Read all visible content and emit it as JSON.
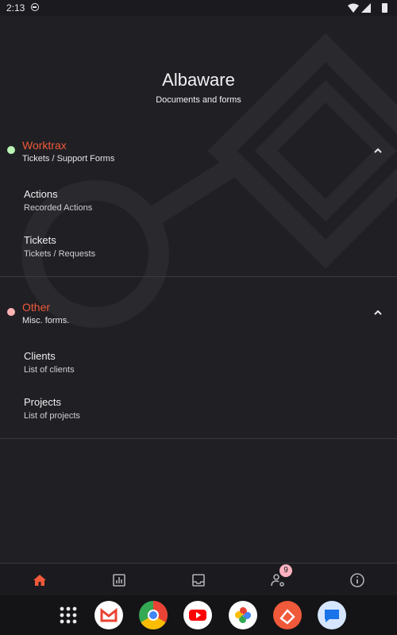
{
  "status_bar": {
    "time": "2:13"
  },
  "header": {
    "title": "Albaware",
    "subtitle": "Documents and forms"
  },
  "sections": [
    {
      "title": "Worktrax",
      "subtitle": "Tickets / Support Forms",
      "dot_color": "#b9f6b4",
      "items": [
        {
          "title": "Actions",
          "subtitle": "Recorded Actions"
        },
        {
          "title": "Tickets",
          "subtitle": "Tickets / Requests"
        }
      ]
    },
    {
      "title": "Other",
      "subtitle": "Misc. forms.",
      "dot_color": "#ffb3b3",
      "items": [
        {
          "title": "Clients",
          "subtitle": "List of clients"
        },
        {
          "title": "Projects",
          "subtitle": "List of projects"
        }
      ]
    }
  ],
  "bottom_nav": {
    "items": [
      {
        "icon": "home-icon",
        "active": true
      },
      {
        "icon": "chart-icon",
        "active": false
      },
      {
        "icon": "inbox-icon",
        "active": false
      },
      {
        "icon": "user-settings-icon",
        "active": false
      },
      {
        "icon": "info-icon",
        "active": false
      }
    ],
    "badge": "9"
  },
  "dock": {
    "apps": [
      "app-drawer-icon",
      "gmail-icon",
      "chrome-icon",
      "youtube-icon",
      "photos-icon",
      "app-icon",
      "messages-icon"
    ]
  },
  "colors": {
    "accent": "#f0593a",
    "background": "#202024"
  }
}
